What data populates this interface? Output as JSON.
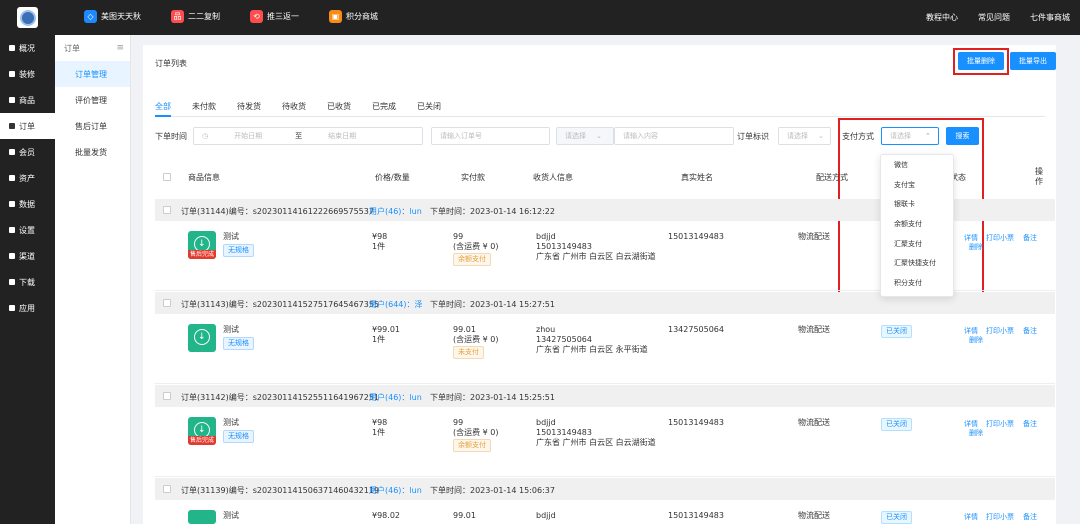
{
  "topbar": {
    "nav": [
      {
        "label": "美图天天秋",
        "color": "#1e88ff",
        "icon": "badge-icon"
      },
      {
        "label": "二二复制",
        "color": "#ff4d4f",
        "icon": "gift-icon"
      },
      {
        "label": "推三返一",
        "color": "#ff4d4f",
        "icon": "share-icon"
      },
      {
        "label": "积分商城",
        "color": "#fa8c16",
        "icon": "shop-icon"
      }
    ],
    "right": [
      "教程中心",
      "常见问题",
      "七件事商城"
    ]
  },
  "sidebar": {
    "items": [
      {
        "label": "概况"
      },
      {
        "label": "装修"
      },
      {
        "label": "商品"
      },
      {
        "label": "订单"
      },
      {
        "label": "会员"
      },
      {
        "label": "资产"
      },
      {
        "label": "数据"
      },
      {
        "label": "设置"
      },
      {
        "label": "渠道"
      },
      {
        "label": "下载"
      },
      {
        "label": "应用"
      }
    ]
  },
  "subnav": {
    "title": "订单",
    "items": [
      {
        "label": "订单管理"
      },
      {
        "label": "评价管理"
      },
      {
        "label": "售后订单"
      },
      {
        "label": "批量发货"
      }
    ]
  },
  "main": {
    "title": "订单列表",
    "batch_delete": "批量删除",
    "batch_export": "批量导出",
    "tabs": [
      "全部",
      "未付款",
      "待发货",
      "待收货",
      "已收货",
      "已完成",
      "已关闭"
    ]
  },
  "filters": {
    "order_time_label": "下单时间",
    "start_date": "开始日期",
    "to": "至",
    "end_date": "结束日期",
    "order_no_ph": "请输入订单号",
    "select_ph": "请选择",
    "content_ph": "请输入内容",
    "order_mark_label": "订单标识",
    "mark_ph": "请选择",
    "pay_label": "支付方式",
    "pay_ph": "请选择",
    "search": "搜索"
  },
  "table_head": {
    "product": "商品信息",
    "price": "价格/数量",
    "paid": "实付款",
    "receiver": "收货人信息",
    "real_name": "真实姓名",
    "delivery": "配送方式",
    "status": "状态",
    "op": "操作"
  },
  "pay_options": [
    "微信",
    "支付宝",
    "银联卡",
    "余额支付",
    "汇聚支付",
    "汇聚快捷支付",
    "积分支付"
  ],
  "orders": [
    {
      "order_id": "订单(31144)编号：s20230114161222669575537",
      "user": "用户(46)：lun",
      "time": "下单时间：2023-01-14 16:12:22",
      "name": "测试",
      "spec": "无规格",
      "badge": "售后完成",
      "price": "¥98",
      "qty": "1件",
      "paid": "99",
      "freight": "(含运费 ¥ 0)",
      "pay_tag": "余额支付",
      "r_name": "bdjjd",
      "r_phone": "15013149483",
      "r_addr": "广东省 广州市 白云区 白云湖街道",
      "real_name": "15013149483",
      "delivery": "物流配送",
      "status": "",
      "ops": [
        "详情",
        "打印小票",
        "备注",
        "删除"
      ]
    },
    {
      "order_id": "订单(31143)编号：s20230114152751764546735​5",
      "user": "用户(644)：泽",
      "time": "下单时间：2023-01-14 15:27:51",
      "name": "测试",
      "spec": "无规格",
      "badge": "",
      "price": "¥99.01",
      "qty": "1件",
      "paid": "99.01",
      "freight": "(含运费 ¥ 0)",
      "pay_tag": "未支付",
      "r_name": "zhou",
      "r_phone": "13427505064",
      "r_addr": "广东省 广州市 白云区 永平街道",
      "real_name": "13427505064",
      "delivery": "物流配送",
      "status": "已关闭",
      "ops": [
        "详情",
        "打印小票",
        "备注",
        "删除"
      ]
    },
    {
      "order_id": "订单(31142)编号：s20230114152551164196725​1",
      "user": "用户(46)：lun",
      "time": "下单时间：2023-01-14 15:25:51",
      "name": "测试",
      "spec": "无规格",
      "badge": "售后完成",
      "price": "¥98",
      "qty": "1件",
      "paid": "99",
      "freight": "(含运费 ¥ 0)",
      "pay_tag": "余额支付",
      "r_name": "bdjjd",
      "r_phone": "15013149483",
      "r_addr": "广东省 广州市 白云区 白云湖街道",
      "real_name": "15013149483",
      "delivery": "物流配送",
      "status": "已关闭",
      "ops": [
        "详情",
        "打印小票",
        "备注",
        "删除"
      ]
    },
    {
      "order_id": "订单(31139)编号：s20230114150637146043211​9",
      "user": "用户(46)：lun",
      "time": "下单时间：2023-01-14 15:06:37",
      "name": "测试",
      "spec": "",
      "badge": "",
      "price": "¥98.02",
      "qty": "",
      "paid": "99.01",
      "freight": "",
      "pay_tag": "",
      "r_name": "bdjjd",
      "r_phone": "",
      "r_addr": "",
      "real_name": "15013149483",
      "delivery": "物流配送",
      "status": "已关闭",
      "ops": [
        "详情",
        "打印小票",
        "备注"
      ]
    }
  ]
}
